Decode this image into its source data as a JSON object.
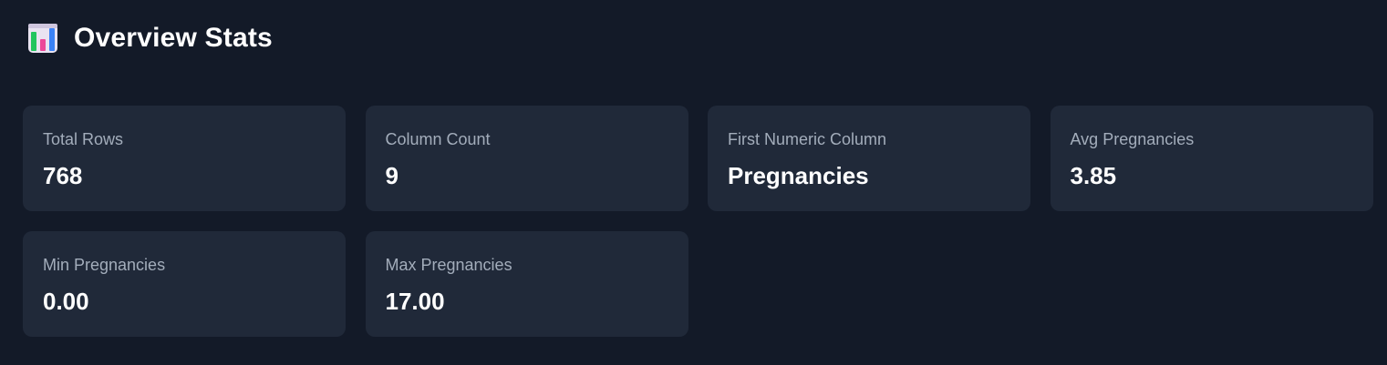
{
  "header": {
    "icon": "bar-chart-icon",
    "title": "Overview Stats"
  },
  "colors": {
    "background": "#131a28",
    "card": "#202939",
    "label": "#a3adbb",
    "value": "#ffffff"
  },
  "stats": [
    {
      "label": "Total Rows",
      "value": "768"
    },
    {
      "label": "Column Count",
      "value": "9"
    },
    {
      "label": "First Numeric Column",
      "value": "Pregnancies"
    },
    {
      "label": "Avg Pregnancies",
      "value": "3.85"
    },
    {
      "label": "Min Pregnancies",
      "value": "0.00"
    },
    {
      "label": "Max Pregnancies",
      "value": "17.00"
    }
  ]
}
